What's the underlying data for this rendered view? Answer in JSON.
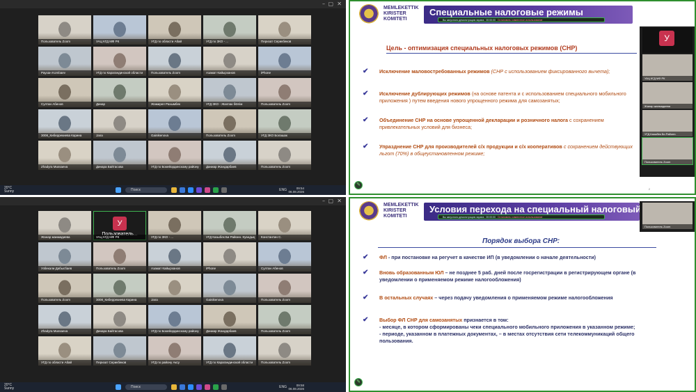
{
  "top_left": {
    "tiles": [
      "Пользователь Zoom",
      "УАЦ КГД МФ РК",
      "УГД по области Абай",
      "УГД по ЗКО - ...",
      "Перизат Серикбеков",
      "Раухан Kombaev",
      "УГД по Карагандинской области",
      "Пользователь Zoom",
      "Азамат Кайырханов",
      "iPhone",
      "Султан Абенов",
      "Динар",
      "Жамирел Рахымбек",
      "УГД ЗКО - Жалпак бӨлім",
      "Пользователь Zoom",
      "3008_Киберрекиева Карина",
      "Jana",
      "Gainikenova",
      "Пользователь Zoom",
      "УГД ЗКО Болашак",
      "Zhadyra Mussaeva",
      "Динара Байтасова",
      "УГД по Бокейординскому району",
      "Даниар Жандарбаев",
      "Пользователь Zoom"
    ],
    "taskbar": {
      "temp": "20°C",
      "weather": "Sunny",
      "search": "Поиск",
      "lang": "ENG",
      "time": "09:54",
      "date": "06.08.2026"
    }
  },
  "bottom_left": {
    "tiles": [
      "Жанар жанмадиева",
      "УАЦ КГД МФ РК",
      "УГД по ЗКО - ...",
      "УГД Казыбек Би Районн. Куандық",
      "Константин С.",
      "Узбекали Дабысбаев",
      "Пользователь Zoom",
      "Азамат Кайырханов",
      "iPhone",
      "Султан Абенов",
      "Пользователь Zoom",
      "3008_Киберрекиева Карина",
      "Jana",
      "Gainikenova",
      "Пользователь Zoom",
      "Zhadyra Mussaeva",
      "Динара Байтасова",
      "УГД по Бокейординскому району",
      "Даниар Жандарбаев",
      "Пользователь Zoom",
      "УГД по области Абай",
      "Перизат Серикбеков",
      "УГД по району Аксу",
      "УГД по Карагандинской области",
      "Пользователь Zoom"
    ],
    "avatar_letter": "У",
    "avatar_name": "Пользователь...",
    "taskbar": {
      "temp": "20°C",
      "weather": "Sunny",
      "search": "Поиск",
      "lang": "ENG",
      "time": "09:58",
      "date": "06.08.2026"
    }
  },
  "slide1": {
    "logo_text": [
      "MEMLEKETTIK",
      "KIRISTER",
      "KOMITETI"
    ],
    "title": "Специальные налоговые режимы",
    "sharebar": {
      "status": "Вы запустили демонстрацию экрана",
      "timer": "00:00:00",
      "stop": "Остановить совместное использование"
    },
    "goal_prefix": "Цель - ",
    "goal_text": "оптимизация специальных налоговых режимов (СНР)",
    "bullets": [
      {
        "bold": "Исключение маловостребованных режимов",
        "rest": " (СНР с использованием фиксированного вычета);"
      },
      {
        "bold": "Исключение дублирующих режимов",
        "rest": " (на основе патента и с использованием специального мобильного приложения ) путем введения нового упрощенного режима для самозанятых;"
      },
      {
        "bold": "Объединение СНР на основе упрощенной декларации и розничного налога",
        "rest": " с сохранением привлекательных условий для бизнеса;"
      },
      {
        "bold": "Упразднение СНР для производителей с/х продукции и с/х кооперативов",
        "rest": " с сохранением действующих льгот (70%) в общеустановленном режиме;"
      }
    ],
    "page": "2",
    "pip": {
      "avatar_letter": "У",
      "tiles": [
        "УАЦ КГД МФ РК",
        "Жанар жанмадиева",
        "УГД Казыбек Би Районн.",
        "Константин С.",
        "Пользователь Zoom"
      ]
    }
  },
  "slide2": {
    "logo_text": [
      "MEMLEKETTIK",
      "KIRISTER",
      "KOMITETI"
    ],
    "title": "Условия перехода на специальный налоговый р",
    "sharebar": {
      "status": "Вы запустили демонстрацию экрана",
      "timer": "00:00:00",
      "stop": "Остановить совместное использование"
    },
    "order_title": "Порядок выбора СНР:",
    "bullets": [
      {
        "lead": "ФЛ",
        "text": " - при постановке на регучет в качестве ИП (в уведомлении о начале деятельности)"
      },
      {
        "lead": "Вновь образованным ЮЛ",
        "text": " – не позднее 5 раб. дней после госрегистрации в регистрирующем органе (в уведомлении о применяемом режиме налогообложения)"
      },
      {
        "lead": "В остальных случаях",
        "text": " – через подачу уведомления о применяемом режиме налогообложения"
      },
      {
        "lead": "Выбор ФЛ СНР для самозанятых",
        "text": " признается в том:"
      }
    ],
    "sub_lines": [
      "- месяце, в котором сформированы чеки специального мобильного приложения в указанном режиме;",
      "- периоде, указанном в платежных документах, – в местах отсутствия сети телекоммуникаций общего пользования."
    ],
    "pip_tile": "Пользователь Zoom"
  }
}
